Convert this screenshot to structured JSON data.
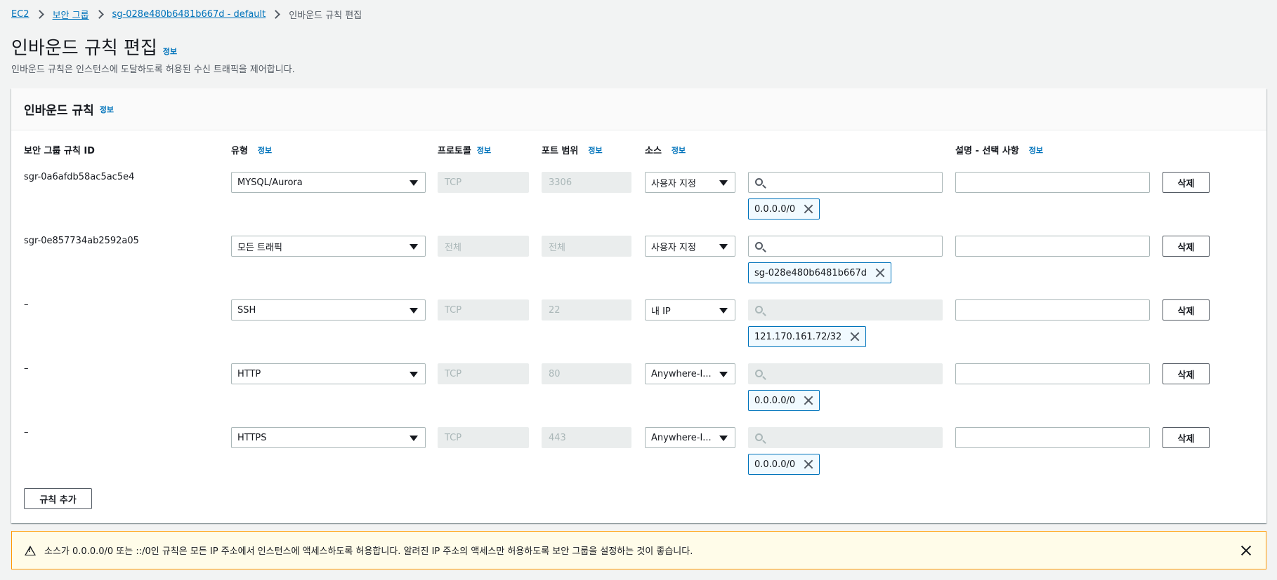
{
  "breadcrumb": {
    "items": [
      "EC2",
      "보안 그룹",
      "sg-028e480b6481b667d - default"
    ],
    "current": "인바운드 규칙 편집"
  },
  "page": {
    "title": "인바운드 규칙 편집",
    "info": "정보",
    "description": "인바운드 규칙은 인스턴스에 도달하도록 허용된 수신 트래픽을 제어합니다."
  },
  "panel": {
    "title": "인바운드 규칙",
    "info": "정보"
  },
  "columns": {
    "rule_id": "보안 그룹 규칙 ID",
    "type": "유형",
    "protocol": "프로토콜",
    "port_range": "포트 범위",
    "source": "소스",
    "description": "설명 - 선택 사항",
    "info": "정보"
  },
  "rules": [
    {
      "id": "sgr-0a6afdb58ac5ac5e4",
      "type": "MYSQL/Aurora",
      "protocol": "TCP",
      "port": "3306",
      "source_type": "사용자 지정",
      "search_disabled": false,
      "token": "0.0.0.0/0",
      "delete": "삭제"
    },
    {
      "id": "sgr-0e857734ab2592a05",
      "type": "모든 트래픽",
      "protocol": "전체",
      "port": "전체",
      "source_type": "사용자 지정",
      "search_disabled": false,
      "token": "sg-028e480b6481b667d",
      "delete": "삭제"
    },
    {
      "id": "–",
      "type": "SSH",
      "protocol": "TCP",
      "port": "22",
      "source_type": "내 IP",
      "search_disabled": true,
      "token": "121.170.161.72/32",
      "delete": "삭제"
    },
    {
      "id": "–",
      "type": "HTTP",
      "protocol": "TCP",
      "port": "80",
      "source_type": "Anywhere-I...",
      "search_disabled": true,
      "token": "0.0.0.0/0",
      "delete": "삭제"
    },
    {
      "id": "–",
      "type": "HTTPS",
      "protocol": "TCP",
      "port": "443",
      "source_type": "Anywhere-I...",
      "search_disabled": true,
      "token": "0.0.0.0/0",
      "delete": "삭제"
    }
  ],
  "add_rule": "규칙 추가",
  "alert": {
    "text": "소스가 0.0.0.0/0 또는 ::/0인 규칙은 모든 IP 주소에서 인스턴스에 액세스하도록 허용합니다. 알려진 IP 주소의 액세스만 허용하도록 보안 그룹을 설정하는 것이 좋습니다.",
    "icon": "warning-icon"
  },
  "colors": {
    "link": "#0073bb",
    "background": "#f2f3f3",
    "token_border": "#0073bb",
    "alert_border": "#ff9900",
    "alert_bg": "#fffce9"
  }
}
